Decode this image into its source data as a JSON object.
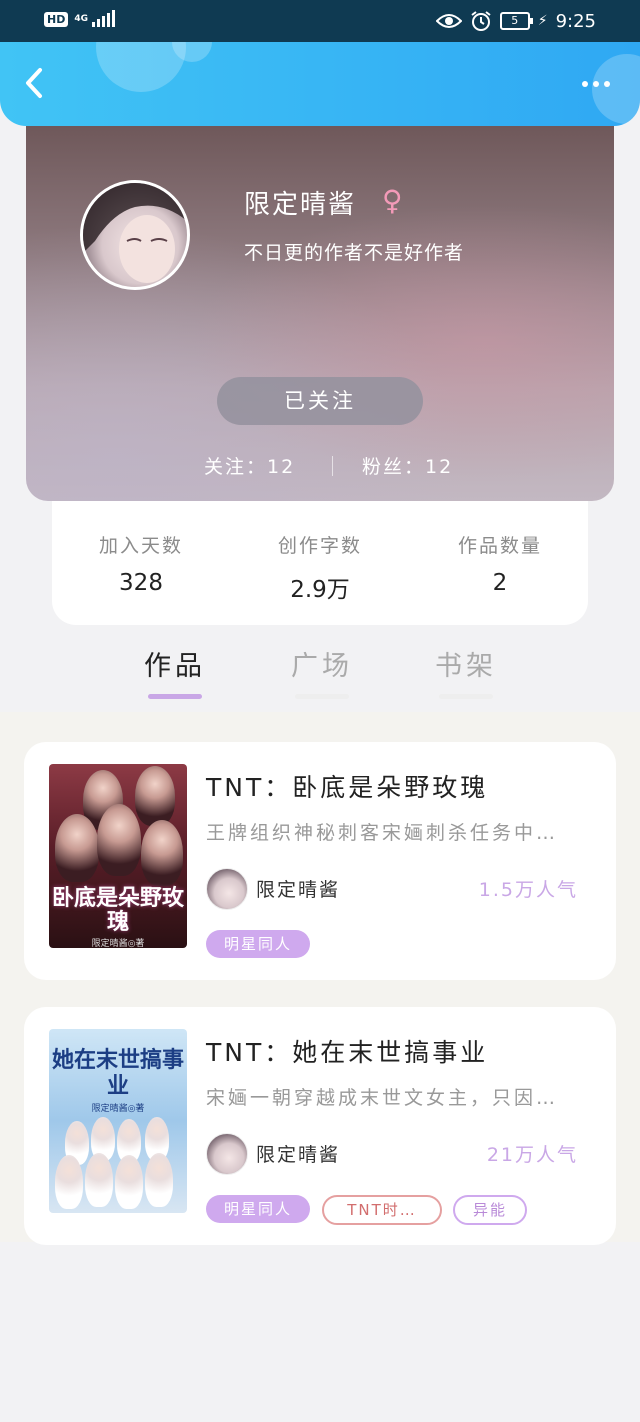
{
  "status_bar": {
    "hd": "HD",
    "network": "4G",
    "battery": "5",
    "time": "9:25"
  },
  "profile": {
    "name": "限定晴酱",
    "gender_symbol": "♀",
    "bio": "不日更的作者不是好作者",
    "follow_button": "已关注",
    "following": "关注：12",
    "fans": "粉丝：12"
  },
  "stats": [
    {
      "label": "加入天数",
      "value": "328"
    },
    {
      "label": "创作字数",
      "value": "2.9万"
    },
    {
      "label": "作品数量",
      "value": "2"
    }
  ],
  "tabs": [
    {
      "label": "作品"
    },
    {
      "label": "广场"
    },
    {
      "label": "书架"
    }
  ],
  "books": [
    {
      "title": "TNT：卧底是朵野玫瑰",
      "description": "王牌组织神秘刺客宋婳刺杀任务中…",
      "author": "限定晴酱",
      "readers": "1.5万人气",
      "cover_title": "卧底是朵野玫瑰",
      "cover_author": "限定晴酱◎著",
      "tags": [
        "明星同人"
      ]
    },
    {
      "title": "TNT：她在末世搞事业",
      "description": "宋婳一朝穿越成末世文女主，只因…",
      "author": "限定晴酱",
      "readers": "21万人气",
      "cover_title": "她在末世搞事业",
      "cover_author": "限定晴酱◎著",
      "tags": [
        "明星同人",
        "TNT时…",
        "异能"
      ]
    }
  ],
  "colors": {
    "nav_gradient": [
      "#41c4f5",
      "#2fa8f3"
    ],
    "accent_purple": "#c9a7e6",
    "status_bar": "#0f3a52"
  },
  "icons": [
    "back-arrow-icon",
    "more-icon",
    "female-icon",
    "eye-icon",
    "alarm-icon",
    "battery-icon",
    "signal-icon"
  ]
}
